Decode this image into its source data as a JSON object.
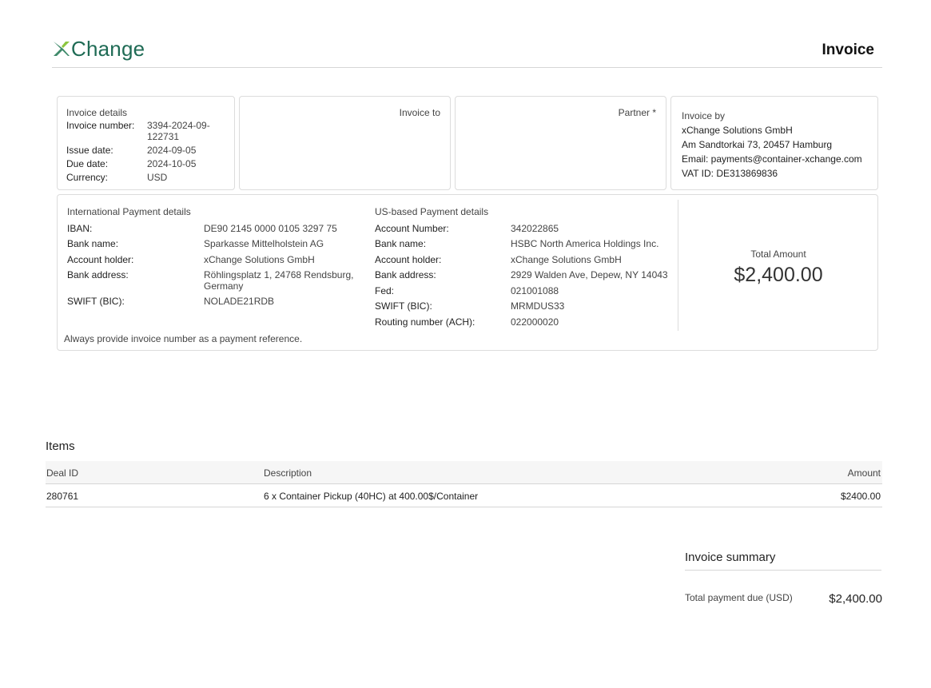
{
  "header": {
    "logo_text": "Change",
    "logo_icon": "x-mark-icon",
    "title": "Invoice"
  },
  "invoice_details": {
    "heading": "Invoice details",
    "number_label": "Invoice number:",
    "number_value_line1": "3394-2024-09-",
    "number_value_line2": "122731",
    "issue_label": "Issue date:",
    "issue_value": "2024-09-05",
    "due_label": "Due date:",
    "due_value": "2024-10-05",
    "currency_label": "Currency:",
    "currency_value": "USD"
  },
  "invoice_to": {
    "heading": "Invoice to"
  },
  "partner": {
    "heading": "Partner *"
  },
  "invoice_by": {
    "heading": "Invoice by",
    "company": "xChange Solutions GmbH",
    "address": "Am Sandtorkai 73, 20457 Hamburg",
    "email": "Email: payments@container-xchange.com",
    "vat": "VAT ID: DE313869836"
  },
  "international": {
    "heading": "International Payment details",
    "iban_label": "IBAN:",
    "iban_value": "DE90 2145 0000 0105 3297 75",
    "bank_label": "Bank name:",
    "bank_value": "Sparkasse Mittelholstein AG",
    "holder_label": "Account holder:",
    "holder_value": "xChange Solutions GmbH",
    "address_label": "Bank address:",
    "address_value_line1": "Röhlingsplatz 1, 24768 Rendsburg,",
    "address_value_line2": "Germany",
    "swift_label": "SWIFT (BIC):",
    "swift_value": "NOLADE21RDB",
    "note": "Always provide invoice number as a payment reference."
  },
  "us": {
    "heading": "US-based Payment details",
    "account_label": "Account Number:",
    "account_value": "342022865",
    "bank_label": "Bank name:",
    "bank_value": "HSBC North America Holdings Inc.",
    "holder_label": "Account holder:",
    "holder_value": "xChange Solutions GmbH",
    "address_label": "Bank address:",
    "address_value": "2929 Walden Ave, Depew, NY 14043",
    "fed_label": "Fed:",
    "fed_value": "021001088",
    "swift_label": "SWIFT (BIC):",
    "swift_value": "MRMDUS33",
    "routing_label": "Routing number (ACH):",
    "routing_value": "022000020"
  },
  "total": {
    "label": "Total Amount",
    "value": "$2,400.00"
  },
  "items": {
    "title": "Items",
    "columns": [
      "Deal ID",
      "Description",
      "Amount"
    ],
    "rows": [
      {
        "deal_id": "280761",
        "description": "6 x Container Pickup (40HC) at 400.00$/Container",
        "amount": "$2400.00"
      }
    ]
  },
  "summary": {
    "title": "Invoice summary",
    "due_label": "Total payment due (USD)",
    "due_value": "$2,400.00"
  },
  "colors": {
    "brand": "#1f6b55",
    "border": "#dcdcdc",
    "table_head_bg": "#f6f6f6"
  }
}
